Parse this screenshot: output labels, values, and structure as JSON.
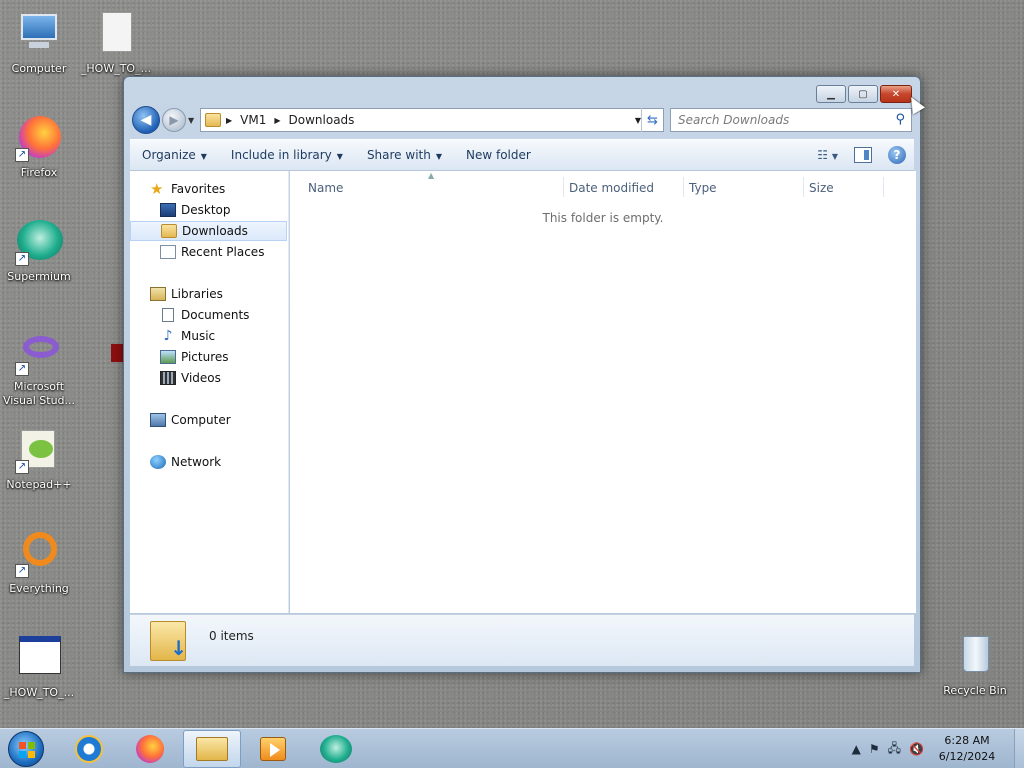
{
  "desktop": {
    "icons": [
      {
        "label": "Computer",
        "icon": "computer-icon"
      },
      {
        "label": "_HOW_TO_...",
        "icon": "document-icon"
      },
      {
        "label": "Firefox",
        "icon": "firefox-icon"
      },
      {
        "label": "Supermium",
        "icon": "supermium-icon"
      },
      {
        "label": "Microsoft Visual Stud...",
        "icon": "visual-studio-icon"
      },
      {
        "label": "Notepad++",
        "icon": "notepadpp-icon"
      },
      {
        "label": "Everything",
        "icon": "everything-icon"
      },
      {
        "label": "_HOW_TO_...",
        "icon": "html-file-icon"
      },
      {
        "label": "Recycle Bin",
        "icon": "recycle-bin-icon"
      }
    ]
  },
  "window": {
    "caption_buttons": {
      "minimize": "▁",
      "maximize": "▢",
      "close": "✕"
    },
    "address": {
      "segments": [
        "VM1",
        "Downloads"
      ]
    },
    "search": {
      "placeholder": "Search Downloads"
    },
    "commands": [
      "Organize",
      "Include in library",
      "Share with",
      "New folder"
    ],
    "nav_pane": {
      "favorites": {
        "label": "Favorites",
        "items": [
          "Desktop",
          "Downloads",
          "Recent Places"
        ],
        "selected": "Downloads"
      },
      "libraries": {
        "label": "Libraries",
        "items": [
          "Documents",
          "Music",
          "Pictures",
          "Videos"
        ]
      },
      "computer": "Computer",
      "network": "Network"
    },
    "columns": [
      "Name",
      "Date modified",
      "Type",
      "Size"
    ],
    "empty_message": "This folder is empty.",
    "details": {
      "item_count": "0 items"
    }
  },
  "taskbar": {
    "pinned": [
      "internet-explorer-icon",
      "firefox-icon",
      "explorer-icon",
      "media-player-icon",
      "supermium-icon"
    ],
    "active": "explorer-icon",
    "clock": {
      "time": "6:28 AM",
      "date": "6/12/2024"
    }
  },
  "colors": {
    "close_button": "#c6452b",
    "selection": "#dbe9fb",
    "taskbar": "#b8cbe0"
  }
}
